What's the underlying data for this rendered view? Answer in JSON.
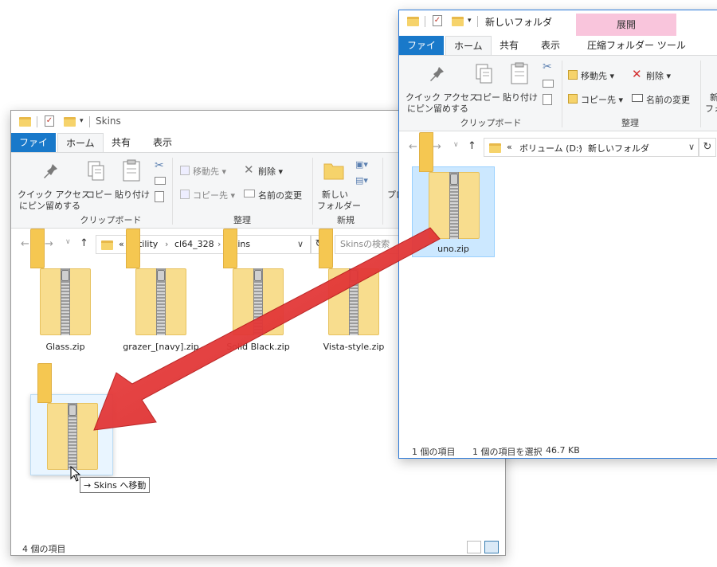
{
  "colors": {
    "file_tab": "#1979ca",
    "context_tab": "#f9c5dc",
    "arrow": "#e03333",
    "selection": "#cce8ff"
  },
  "win1": {
    "title": "Skins",
    "tabs": {
      "file": "ファイル",
      "home": "ホーム",
      "share": "共有",
      "view": "表示"
    },
    "ribbon": {
      "pin_quick_access": [
        "クイック アクセス",
        "にピン留めする"
      ],
      "copy": "コピー",
      "paste": "貼り付け",
      "move_to": "移動先",
      "copy_to": "コピー先",
      "delete": "削除",
      "rename": "名前の変更",
      "new_folder": [
        "新しい",
        "フォルダー"
      ],
      "properties_partial": "プロ",
      "groups": {
        "clipboard": "クリップボード",
        "organize": "整理",
        "new": "新規"
      }
    },
    "address": {
      "prefix": "«",
      "crumbs": [
        "utility",
        "cl64_328",
        "Skins"
      ],
      "search_placeholder": "Skinsの検索"
    },
    "files": [
      "Glass.zip",
      "grazer_[navy].zip",
      "Solid Black.zip",
      "Vista-style.zip"
    ],
    "drag_tooltip": "→ Skins へ移動",
    "status": "4 個の項目"
  },
  "win2": {
    "title": "新しいフォルダ",
    "context_label": "展開",
    "tabs": {
      "file": "ファイル",
      "home": "ホーム",
      "share": "共有",
      "view": "表示",
      "compress_tools": "圧縮フォルダー ツール"
    },
    "ribbon": {
      "pin_quick_access": [
        "クイック アクセス",
        "にピン留めする"
      ],
      "copy": "コピー",
      "paste": "貼り付け",
      "move_to": "移動先",
      "copy_to": "コピー先",
      "delete": "削除",
      "rename": "名前の変更",
      "new_partial": [
        "新",
        "フォ"
      ],
      "groups": {
        "clipboard": "クリップボード",
        "organize": "整理"
      }
    },
    "address": {
      "prefix": "«",
      "crumbs": [
        "ボリューム (D:)",
        "新しいフォルダ"
      ]
    },
    "files": [
      "uno.zip"
    ],
    "status": {
      "count": "1 個の項目",
      "selected": "1 個の項目を選択",
      "size": "46.7 KB"
    }
  }
}
